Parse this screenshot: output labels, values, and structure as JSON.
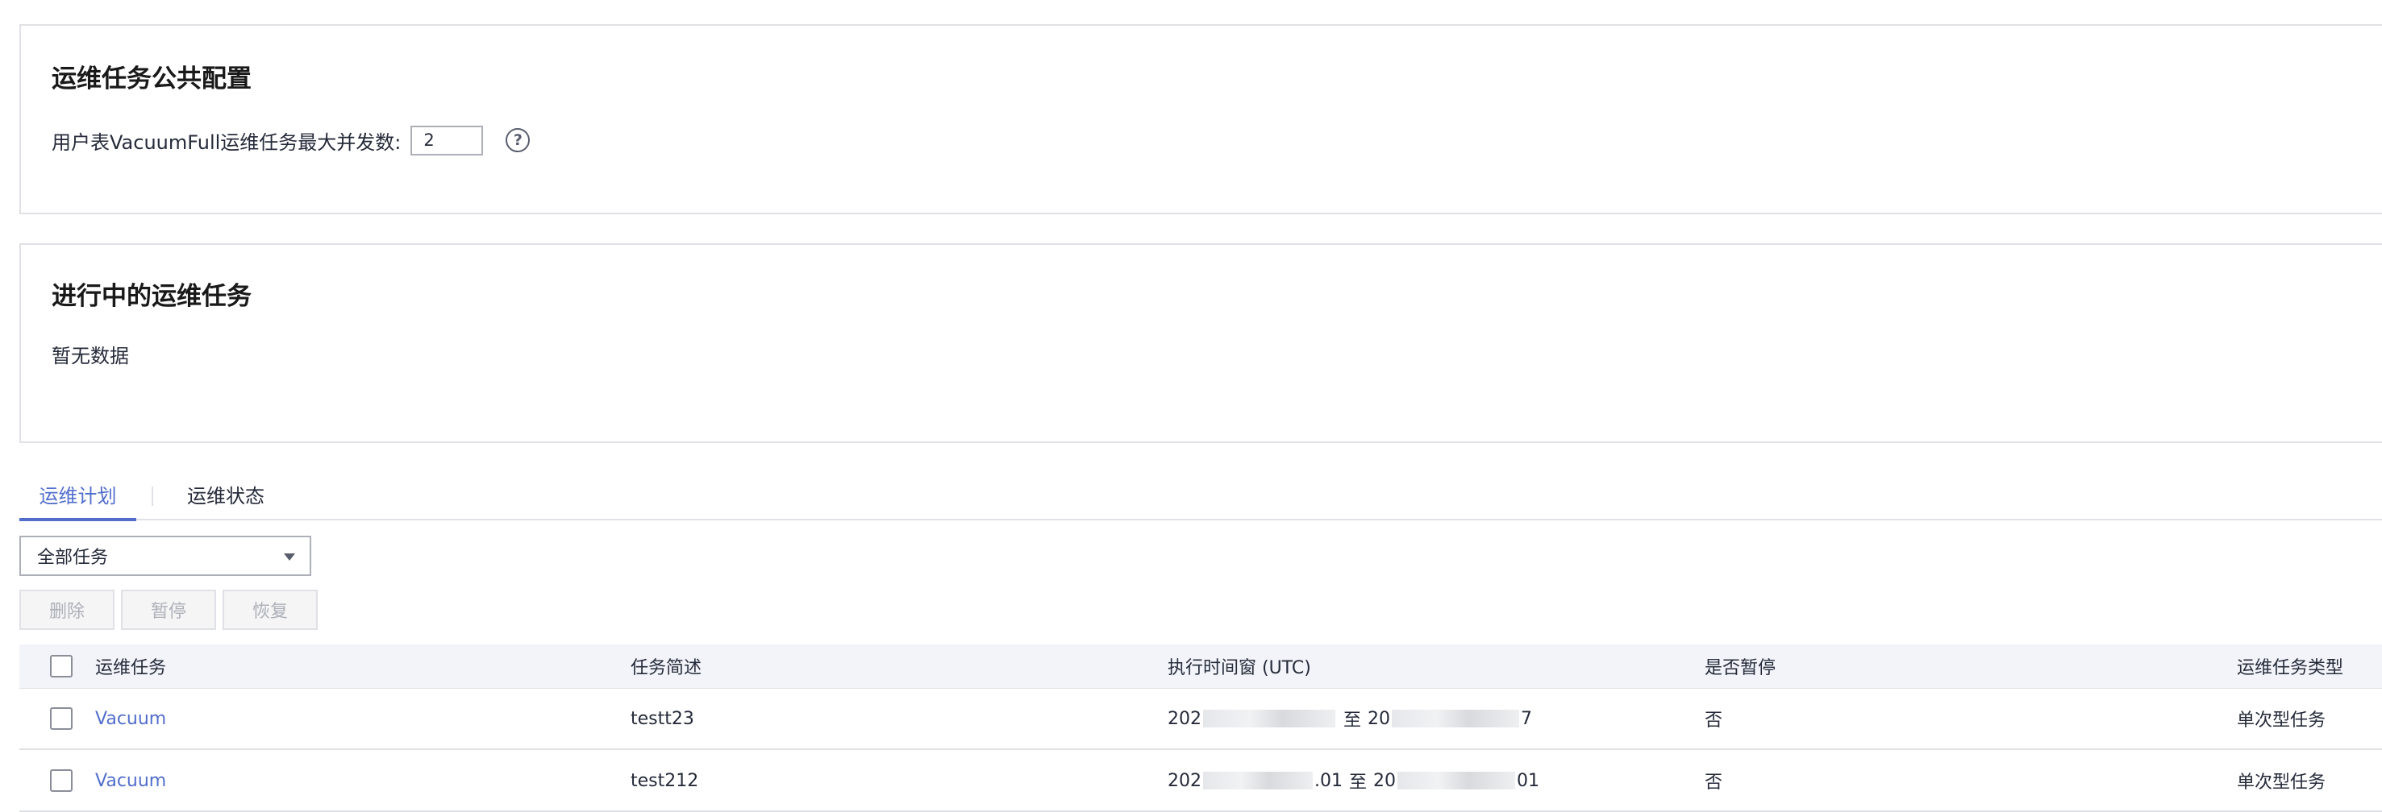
{
  "config_section": {
    "title": "运维任务公共配置",
    "setting_label": "用户表VacuumFull运维任务最大并发数:",
    "setting_value": "2",
    "help_symbol": "?"
  },
  "running_section": {
    "title": "进行中的运维任务",
    "empty_text": "暂无数据"
  },
  "tabs": [
    {
      "label": "运维计划",
      "active": true
    },
    {
      "label": "运维状态",
      "active": false
    }
  ],
  "filter": {
    "selected": "全部任务"
  },
  "actions": {
    "delete_label": "删除",
    "pause_label": "暂停",
    "resume_label": "恢复"
  },
  "table": {
    "columns": {
      "task": "运维任务",
      "desc": "任务简述",
      "window": "执行时间窗 (UTC)",
      "paused": "是否暂停",
      "type": "运维任务类型"
    },
    "rows": [
      {
        "task": "Vacuum",
        "desc": "testt23",
        "window_start": "202",
        "window_start_tail": "",
        "window_sep": "至",
        "window_end": "20",
        "window_end_tail": "7",
        "paused": "否",
        "type": "单次型任务"
      },
      {
        "task": "Vacuum",
        "desc": "test212",
        "window_start": "202",
        "window_start_tail": ".01",
        "window_sep": "至",
        "window_end": "20",
        "window_end_tail": "01",
        "paused": "否",
        "type": "单次型任务"
      }
    ]
  },
  "colors": {
    "accent": "#526ecc",
    "border": "#dfe1e6",
    "header_bg": "#f2f4f9",
    "disabled_text": "#adb0b8"
  }
}
